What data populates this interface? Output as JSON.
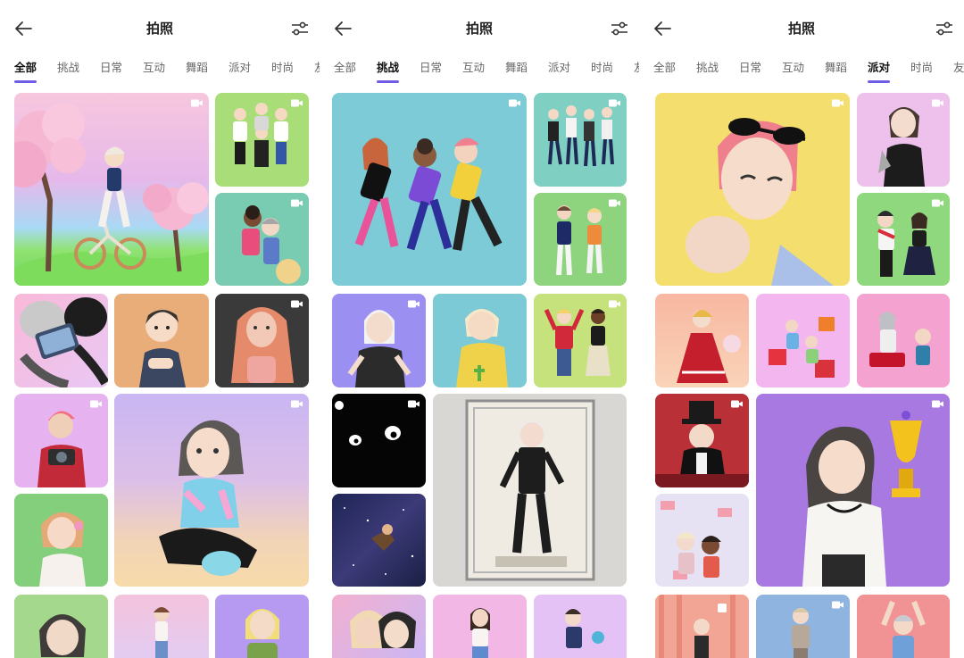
{
  "screens": [
    {
      "title": "拍照",
      "tabs": [
        "全部",
        "挑战",
        "日常",
        "互动",
        "舞蹈",
        "派对",
        "时尚",
        "友"
      ],
      "active_tab": 0
    },
    {
      "title": "拍照",
      "tabs": [
        "全部",
        "挑战",
        "日常",
        "互动",
        "舞蹈",
        "派对",
        "时尚",
        "友"
      ],
      "active_tab": 1
    },
    {
      "title": "拍照",
      "tabs": [
        "全部",
        "挑战",
        "日常",
        "互动",
        "舞蹈",
        "派对",
        "时尚",
        "友"
      ],
      "active_tab": 5
    }
  ],
  "icons": {
    "back": "arrow-left-icon",
    "filter": "sliders-icon",
    "video": "video-camera-icon"
  },
  "colors": {
    "accent": "#6f5de8",
    "text_primary": "#222222",
    "tab_inactive": "#666666"
  },
  "tiles": {
    "screen0": [
      {
        "bg": "linear-gradient(180deg,#f7c7de 0%,#e6b8ea 45%,#a9d9f5 70%,#8fe36f 82%,#6fd467 100%)",
        "video": true
      },
      {
        "bg": "#a8dd78",
        "video": true
      },
      {
        "bg": "#79cbb1",
        "video": true
      },
      {
        "bg": "linear-gradient(135deg,#f9b8d8,#e9c8f5)",
        "video": false
      },
      {
        "bg": "#e9ad7a",
        "video": false
      },
      {
        "bg": "#3a3a3a",
        "video": true
      },
      {
        "bg": "#e6b3f0",
        "video": true
      },
      {
        "bg": "linear-gradient(180deg,#c9b6f2 0%,#dcbfe8 45%,#f1d3b8 75%,#f7dba8 100%)",
        "video": true
      },
      {
        "bg": "#84cf7c",
        "video": false
      },
      {
        "bg": "#a3d88d",
        "video": false
      },
      {
        "bg": "linear-gradient(180deg,#f4c3dc,#e1cdf5)",
        "video": false
      },
      {
        "bg": "#b69af2",
        "video": false
      }
    ],
    "screen1": [
      {
        "bg": "#7ccbd6",
        "video": true
      },
      {
        "bg": "#7fd0c2",
        "video": true
      },
      {
        "bg": "#8ed47f",
        "video": true
      },
      {
        "bg": "#9c8ff2",
        "video": true
      },
      {
        "bg": "#7ccad6",
        "video": false
      },
      {
        "bg": "#c5e27c",
        "video": true
      },
      {
        "bg": "#050505",
        "video": true
      },
      {
        "bg": "#d9d7d4",
        "video": false
      },
      {
        "bg": "linear-gradient(135deg,#1f2555,#3c3a78,#1a1f44)",
        "video": false
      },
      {
        "bg": "linear-gradient(135deg,#f2b0d0,#c9b7f5)",
        "video": false
      },
      {
        "bg": "#f3b7e6",
        "video": false
      },
      {
        "bg": "#e5c2f5",
        "video": false
      }
    ],
    "screen2": [
      {
        "bg": "#f4df6e",
        "video": true
      },
      {
        "bg": "#eec0ec",
        "video": true
      },
      {
        "bg": "#8fd87d",
        "video": true
      },
      {
        "bg": "linear-gradient(180deg,#f8b7a1,#f9d4b8)",
        "video": false
      },
      {
        "bg": "#f4b6ee",
        "video": false
      },
      {
        "bg": "#f4a2cf",
        "video": false
      },
      {
        "bg": "#b93037",
        "video": true
      },
      {
        "bg": "#a979e2",
        "video": true
      },
      {
        "bg": "#e7e2f3",
        "video": false
      },
      {
        "bg": "#f2a595",
        "video": false
      },
      {
        "bg": "#8fb4e0",
        "video": true
      },
      {
        "bg": "#f19294",
        "video": false
      }
    ]
  }
}
